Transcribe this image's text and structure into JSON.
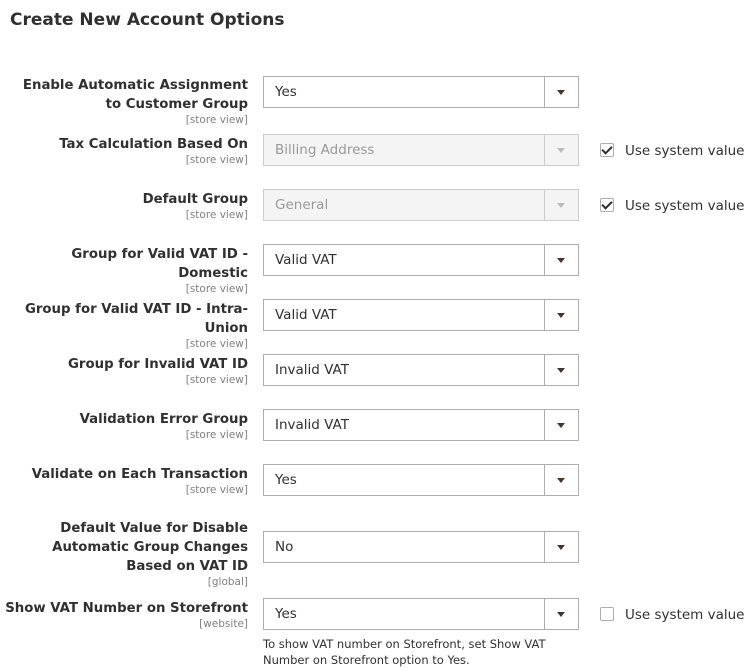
{
  "section_title": "Create New Account Options",
  "use_system_value_label": "Use system value",
  "fields": [
    {
      "label": "Enable Automatic Assignment to Customer Group",
      "scope": "[store view]",
      "value": "Yes"
    },
    {
      "label": "Tax Calculation Based On",
      "scope": "[store view]",
      "value": "Billing Address",
      "use_system_value": true
    },
    {
      "label": "Default Group",
      "scope": "[store view]",
      "value": "General",
      "use_system_value": true
    },
    {
      "label": "Group for Valid VAT ID - Domestic",
      "scope": "[store view]",
      "value": "Valid VAT"
    },
    {
      "label": "Group for Valid VAT ID - Intra-Union",
      "scope": "[store view]",
      "value": "Valid VAT"
    },
    {
      "label": "Group for Invalid VAT ID",
      "scope": "[store view]",
      "value": "Invalid VAT"
    },
    {
      "label": "Validation Error Group",
      "scope": "[store view]",
      "value": "Invalid VAT"
    },
    {
      "label": "Validate on Each Transaction",
      "scope": "[store view]",
      "value": "Yes"
    },
    {
      "label": "Default Value for Disable Automatic Group Changes Based on VAT ID",
      "scope": "[global]",
      "value": "No"
    },
    {
      "label": "Show VAT Number on Storefront",
      "scope": "[website]",
      "value": "Yes",
      "use_system_value": false
    }
  ],
  "note": "To show VAT number on Storefront, set Show VAT Number on Storefront option to Yes."
}
